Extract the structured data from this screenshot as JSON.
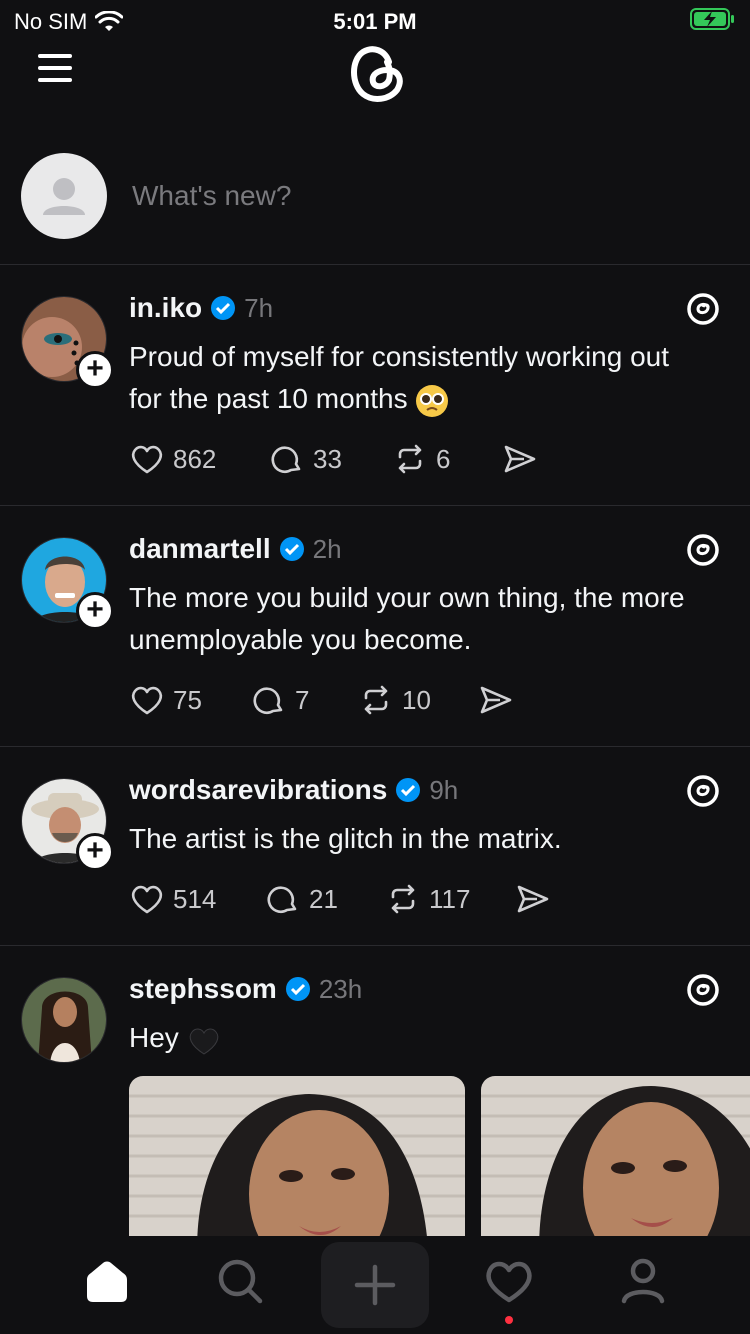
{
  "status_bar": {
    "carrier": "No SIM",
    "time": "5:01 PM",
    "battery_color": "#34c759"
  },
  "app": {
    "logo_icon": "threads-logo-icon",
    "menu_icon": "menu-icon"
  },
  "composer": {
    "placeholder": "What's new?"
  },
  "posts": [
    {
      "username": "in.iko",
      "time": "7h",
      "verified": true,
      "text": "Proud of myself for consistently working out for the past 10 months",
      "emoji": "pleading-face-emoji",
      "likes": "862",
      "replies": "33",
      "reposts": "6"
    },
    {
      "username": "danmartell",
      "time": "2h",
      "verified": true,
      "text": "The more you build your own thing, the more unemployable you become.",
      "likes": "75",
      "replies": "7",
      "reposts": "10"
    },
    {
      "username": "wordsarevibrations",
      "time": "9h",
      "verified": true,
      "text": "The artist is the glitch in the matrix.",
      "likes": "514",
      "replies": "21",
      "reposts": "117"
    },
    {
      "username": "stephssom",
      "time": "23h",
      "verified": true,
      "text": "Hey",
      "emoji": "black-heart-emoji"
    }
  ],
  "tab_bar": {
    "tabs": [
      "home-icon",
      "search-icon",
      "create-icon",
      "activity-icon",
      "profile-icon"
    ],
    "notification_color": "#ff3040"
  },
  "colors": {
    "background": "#101012",
    "verified": "#0095f6",
    "text": "#f3f5f7",
    "muted": "#77777b"
  }
}
